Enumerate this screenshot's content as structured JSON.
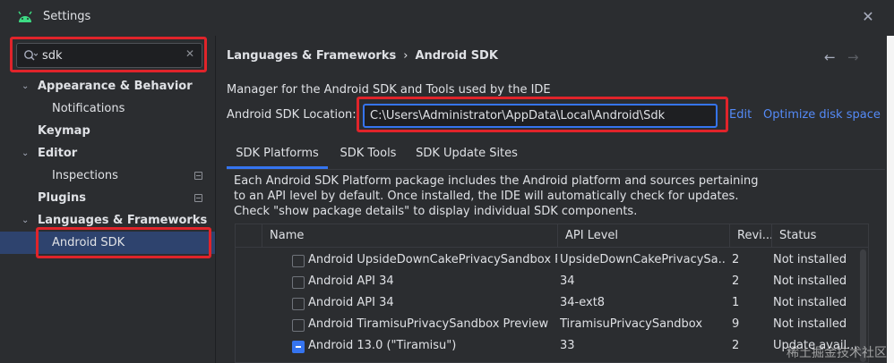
{
  "window": {
    "title": "Settings",
    "app_icon": "android-icon",
    "close_icon": "close-icon"
  },
  "sidebar": {
    "search": {
      "value": "sdk",
      "icon": "search-icon",
      "clear_icon": "clear-icon"
    },
    "items": [
      {
        "label": "Appearance & Behavior",
        "expanded": true
      },
      {
        "label": "Notifications"
      },
      {
        "label": "Keymap"
      },
      {
        "label": "Editor",
        "expanded": true
      },
      {
        "label": "Inspections"
      },
      {
        "label": "Plugins"
      },
      {
        "label": "Languages & Frameworks",
        "expanded": true
      },
      {
        "label": "Android SDK",
        "selected": true
      }
    ]
  },
  "main": {
    "breadcrumb": {
      "parent": "Languages & Frameworks",
      "separator": "›",
      "current": "Android SDK"
    },
    "nav": {
      "back_icon": "arrow-left-icon",
      "forward_icon": "arrow-right-icon"
    },
    "description": "Manager for the Android SDK and Tools used by the IDE",
    "location": {
      "label": "Android SDK Location:",
      "value": "C:\\Users\\Administrator\\AppData\\Local\\Android\\Sdk",
      "edit_label": "Edit",
      "optimize_label": "Optimize disk space"
    },
    "tabs": [
      {
        "label": "SDK Platforms",
        "active": true
      },
      {
        "label": "SDK Tools"
      },
      {
        "label": "SDK Update Sites"
      }
    ],
    "platform_description": "Each Android SDK Platform package includes the Android platform and sources pertaining to an API level by default. Once installed, the IDE will automatically check for updates. Check \"show package details\" to display individual SDK components.",
    "table": {
      "headers": [
        "Name",
        "API Level",
        "Revi...",
        "Status"
      ],
      "rows": [
        {
          "name": "Android UpsideDownCakePrivacySandbox Pr",
          "api": "UpsideDownCakePrivacySa...",
          "rev": "2",
          "status": "Not installed",
          "checked": "none"
        },
        {
          "name": "Android API 34",
          "api": "34",
          "rev": "2",
          "status": "Not installed",
          "checked": "none"
        },
        {
          "name": "Android API 34",
          "api": "34-ext8",
          "rev": "1",
          "status": "Not installed",
          "checked": "none"
        },
        {
          "name": "Android TiramisuPrivacySandbox Preview",
          "api": "TiramisuPrivacySandbox",
          "rev": "9",
          "status": "Not installed",
          "checked": "none"
        },
        {
          "name": "Android 13.0 (\"Tiramisu\")",
          "api": "33",
          "rev": "2",
          "status": "Update avail...",
          "checked": "partial"
        }
      ]
    }
  },
  "watermark": "稀土掘金技术社区",
  "colors": {
    "accent": "#3574f0",
    "highlight_box": "#e0242a",
    "selection": "#2e436e",
    "link": "#548af7"
  }
}
